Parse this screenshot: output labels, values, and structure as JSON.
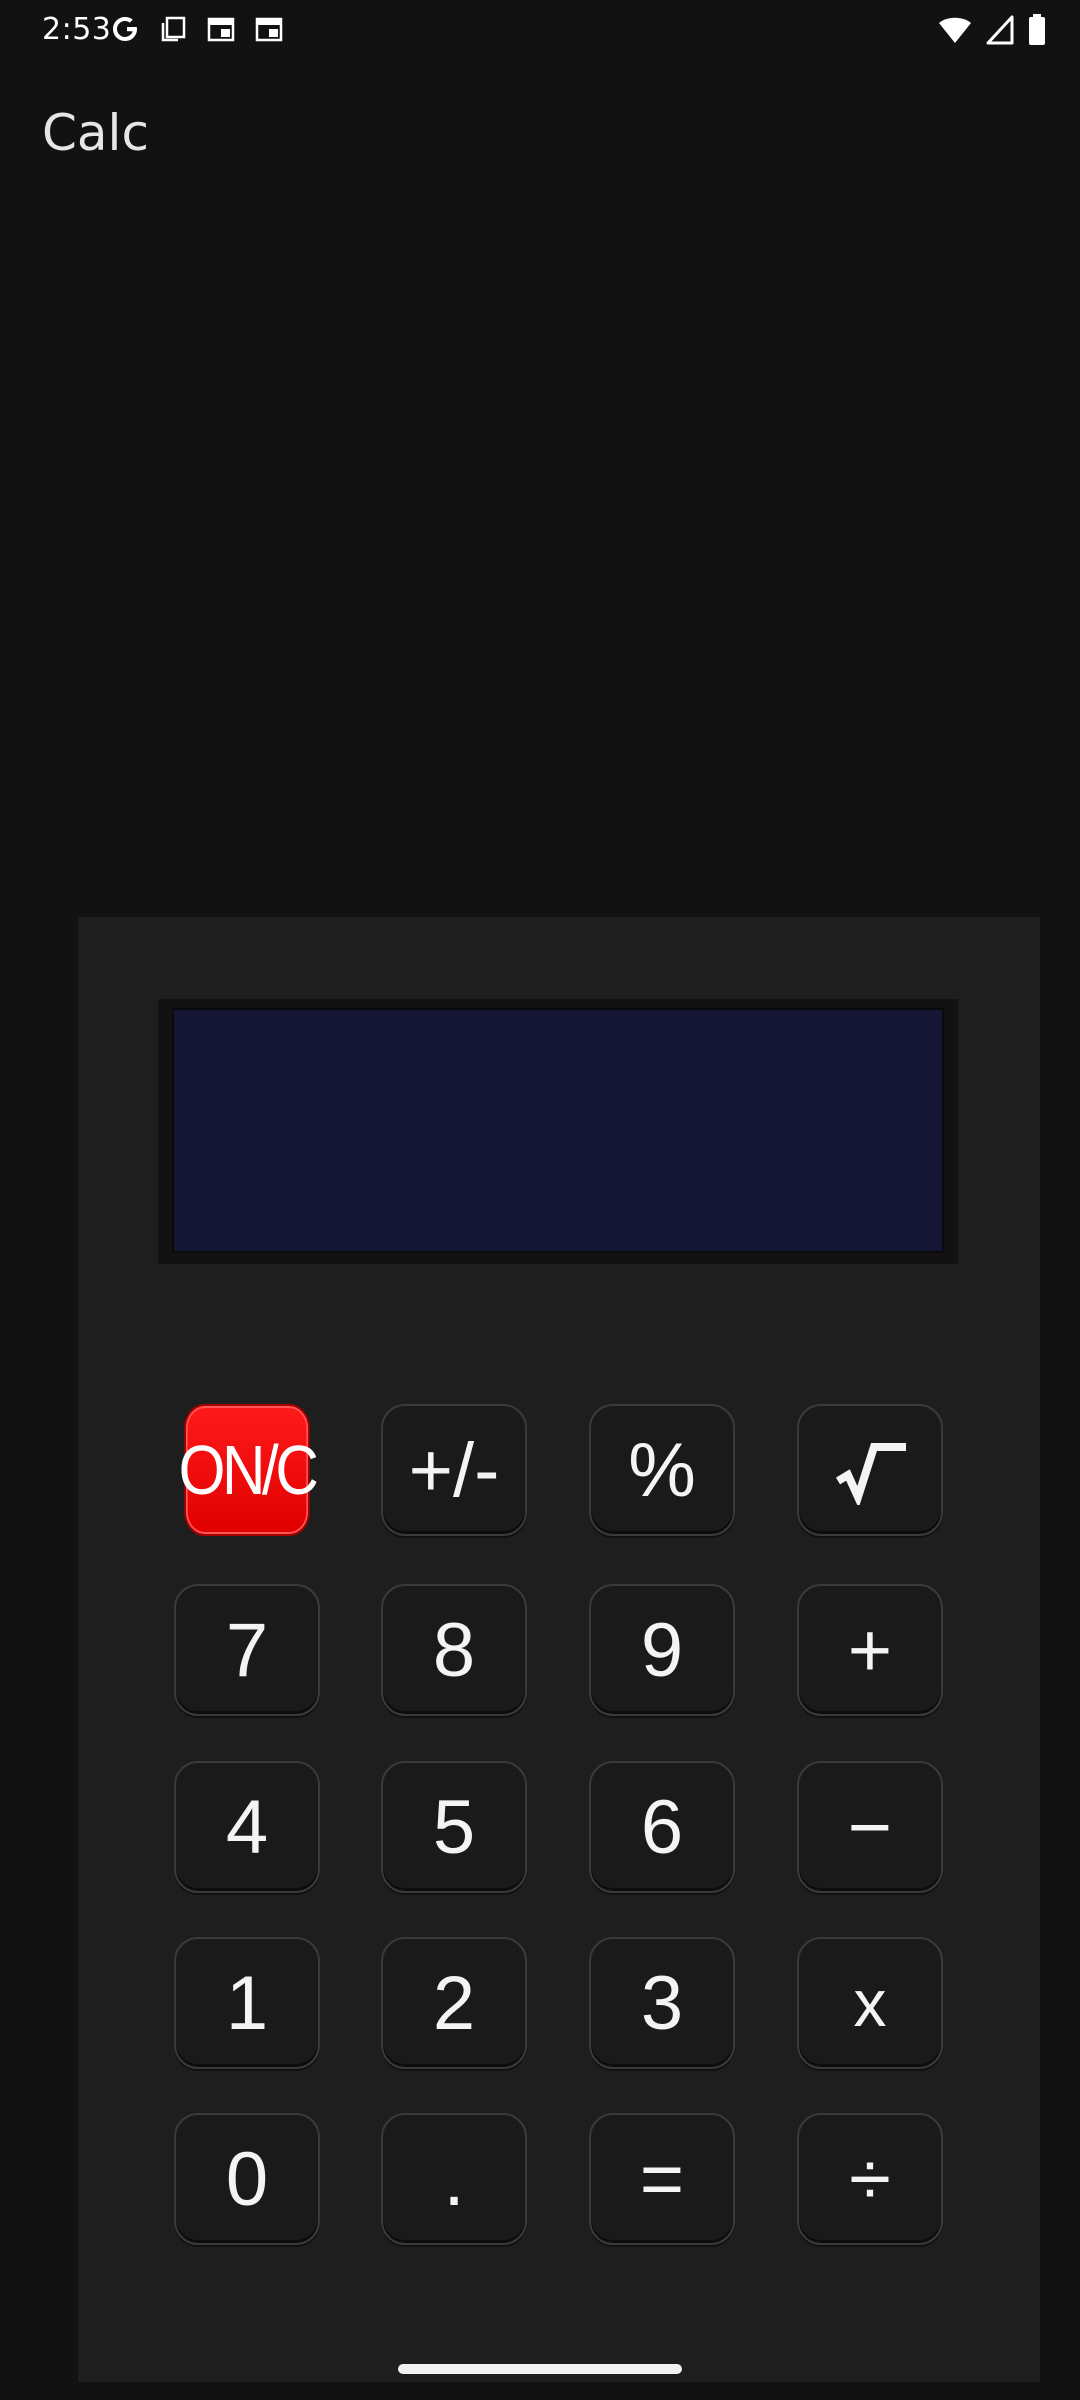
{
  "status_bar": {
    "time": "2:53",
    "left_icons": [
      "google-icon",
      "copy-icon",
      "calendar-icon",
      "calendar-icon"
    ],
    "right_icons": [
      "wifi-icon",
      "signal-icon",
      "battery-icon"
    ]
  },
  "app": {
    "title": "Calc"
  },
  "display": {
    "value": ""
  },
  "keys": {
    "onc": "ON/C",
    "plus_minus": "+/-",
    "percent": "%",
    "sqrt": "√",
    "seven": "7",
    "eight": "8",
    "nine": "9",
    "add": "+",
    "four": "4",
    "five": "5",
    "six": "6",
    "subtract": "−",
    "one": "1",
    "two": "2",
    "three": "3",
    "multiply": "x",
    "zero": "0",
    "decimal": ".",
    "equals": "=",
    "divide": "÷"
  },
  "colors": {
    "background": "#121212",
    "calc_body": "#1e1e1e",
    "display": "#151535",
    "accent_red": "#ff0000"
  }
}
